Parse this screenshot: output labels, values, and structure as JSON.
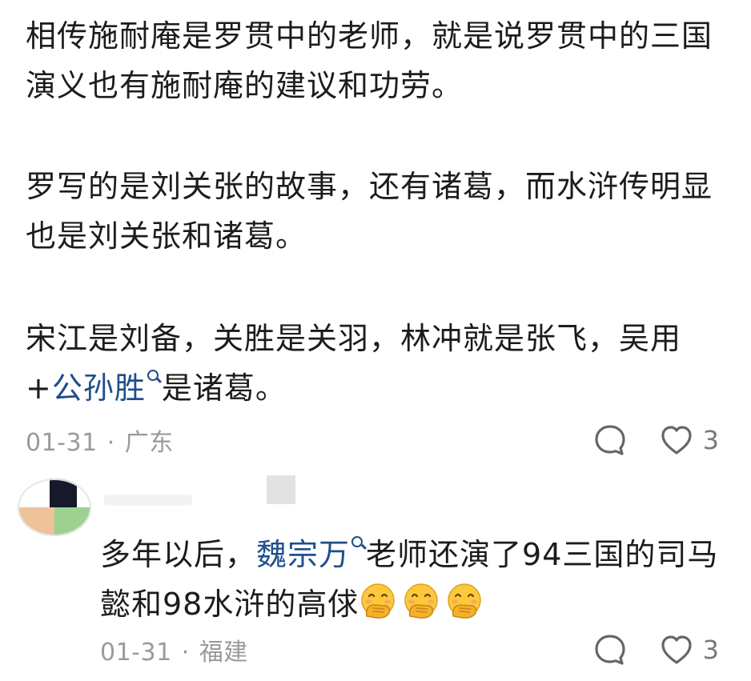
{
  "comment": {
    "paragraphs": {
      "p1": "相传施耐庵是罗贯中的老师，就是说罗贯中的三国演义也有施耐庵的建议和功劳。",
      "p2": "罗写的是刘关张的故事，还有诸葛，而水浒传明显也是刘关张和诸葛。",
      "p3_before": "宋江是刘备，关胜是关羽，林冲就是张飞，吴用+",
      "p3_mention": "公孙胜",
      "p3_after": "是诸葛。"
    },
    "date": "01-31",
    "separator": "·",
    "location": "广东",
    "like_count": "3",
    "reply_icon": "comment-bubble-icon",
    "like_icon": "heart-icon"
  },
  "reply": {
    "text_before": "多年以后，",
    "mention": "魏宗万",
    "text_after": "老师还演了94三国的司马懿和98水浒的高俅",
    "emoji": [
      "face-with-hand-over-mouth-emoji",
      "face-with-hand-over-mouth-emoji",
      "face-with-hand-over-mouth-emoji"
    ],
    "date": "01-31",
    "separator": "·",
    "location": "福建",
    "like_count": "3"
  },
  "colors": {
    "mention": "#1f4e8c",
    "meta": "#9a9a9a",
    "text": "#1c1c1c"
  }
}
